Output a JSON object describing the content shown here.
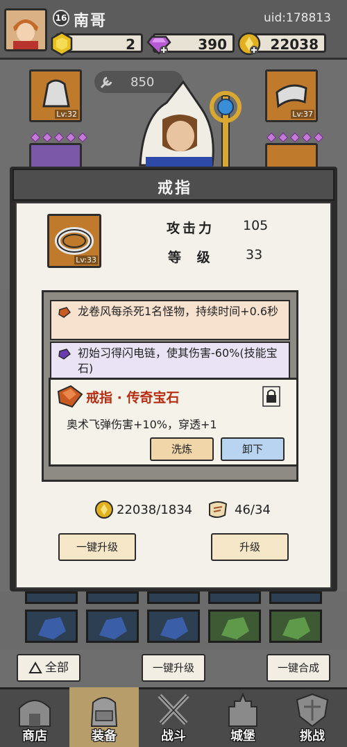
{
  "player": {
    "level": "16",
    "name": "南哥",
    "uid": "uid:178813"
  },
  "resources": {
    "gold": "2",
    "gems": "390",
    "coins": "22038"
  },
  "character": {
    "power": "850",
    "left_slot_level": "Lv:32",
    "right_slot_level": "Lv:37"
  },
  "modal": {
    "title": "戒指",
    "item_level": "Lv:33",
    "stats": [
      {
        "label": "攻击力",
        "value": "105"
      },
      {
        "label": "等 级",
        "value": "33"
      }
    ],
    "gem_effects": [
      "龙卷风每杀死1名怪物，持续时间+0.6秒",
      "初始习得闪电链，使其伤害-60%(技能宝石)"
    ],
    "legendary": {
      "title": "戒指 · 传奇宝石",
      "description": "奥术飞弹伤害+10%，穿透+1",
      "refine_label": "洗炼",
      "unload_label": "卸下"
    },
    "cost": {
      "coins": "22038/1834",
      "scrolls": "46/34"
    },
    "one_click_upgrade_label": "一键升级",
    "upgrade_label": "升级"
  },
  "inventory": {
    "filter_label": "全部",
    "one_click_upgrade_label": "一键升级",
    "one_click_merge_label": "一键合成"
  },
  "nav": [
    {
      "label": "商店"
    },
    {
      "label": "装备"
    },
    {
      "label": "战斗"
    },
    {
      "label": "城堡"
    },
    {
      "label": "挑战"
    }
  ],
  "colors": {
    "legendary_title": "#b62d12",
    "refine_button": "#f0d6a8",
    "unload_button": "#b8d4f0",
    "active_nav": "#b79d6a"
  }
}
